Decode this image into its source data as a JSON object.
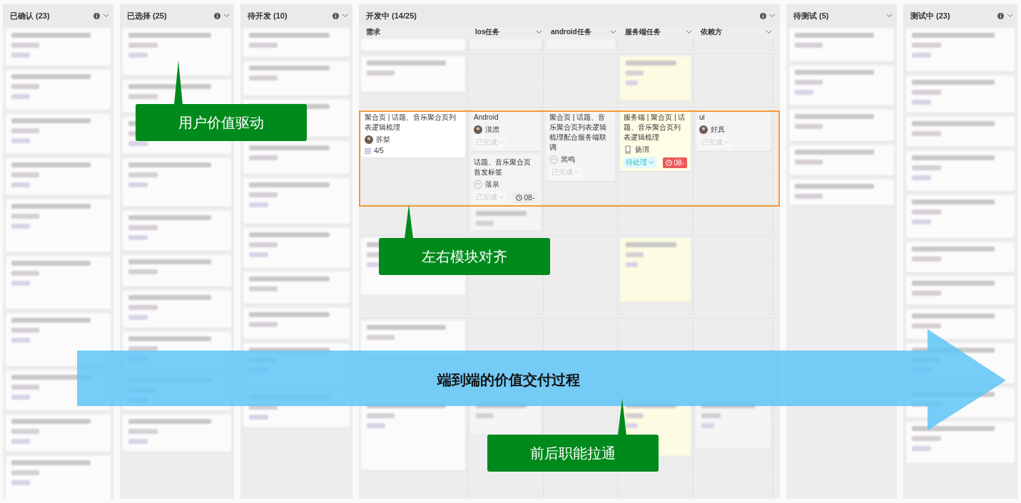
{
  "columns": [
    {
      "title": "已确认 (23)",
      "info": true
    },
    {
      "title": "已选择 (25)",
      "info": true
    },
    {
      "title": "待开发 (10)",
      "info": true
    },
    {
      "title": "开发中 (14/25)",
      "info": true,
      "kind": "swimlane"
    },
    {
      "title": "待测试 (5)",
      "info": false
    },
    {
      "title": "测试中 (23)",
      "info": true
    }
  ],
  "dev_subcolumns": [
    {
      "label": "需求",
      "dropdown": false
    },
    {
      "label": "Ios任务",
      "dropdown": true
    },
    {
      "label": "android任务",
      "dropdown": true
    },
    {
      "label": "服务端任务",
      "dropdown": true
    },
    {
      "label": "依赖方",
      "dropdown": true
    }
  ],
  "focus_lane": {
    "cells": [
      [
        {
          "kind": "requirement",
          "title": "聚合页 | 话题、音乐聚合页列表逻辑梳理",
          "assignee": "苏桀",
          "avatar": {
            "kind": "photo"
          },
          "progress": "4/5"
        }
      ],
      [
        {
          "kind": "task",
          "title": "Android",
          "assignee": "漠澹",
          "avatar": {
            "kind": "photo"
          },
          "status": {
            "text": "已完成",
            "kind": "done"
          }
        },
        {
          "kind": "task",
          "title": "话题、音乐聚合页首发标签",
          "assignee": "落泉",
          "avatar": {
            "kind": "outline"
          },
          "status": {
            "text": "已完成",
            "kind": "done"
          },
          "due": {
            "text": "08-",
            "overdue": false
          }
        }
      ],
      [
        {
          "kind": "task",
          "title": "聚合页 | 话题、音乐聚合页列表逻辑梳理配合服务端联调",
          "assignee": "黑鸣",
          "avatar": {
            "kind": "outline"
          },
          "status": {
            "text": "已完成",
            "kind": "done"
          }
        }
      ],
      [
        {
          "kind": "flagged",
          "title": "服务端 | 聚合页 | 话题、音乐聚合页列表逻辑梳理",
          "assignee": "扬渭",
          "avatar": {
            "kind": "figure"
          },
          "status": {
            "text": "待处理",
            "kind": "pending"
          },
          "due": {
            "text": "08-",
            "overdue": true
          }
        }
      ],
      [
        {
          "kind": "task",
          "title": "ui",
          "assignee": "好真",
          "avatar": {
            "kind": "photo"
          },
          "status": {
            "text": "已完成",
            "kind": "done"
          }
        }
      ]
    ]
  },
  "callouts": [
    {
      "text": "用户价值驱动"
    },
    {
      "text": "左右模块对齐"
    },
    {
      "text": "前后职能拉通"
    }
  ],
  "banner": {
    "text": "端到端的价值交付过程"
  }
}
